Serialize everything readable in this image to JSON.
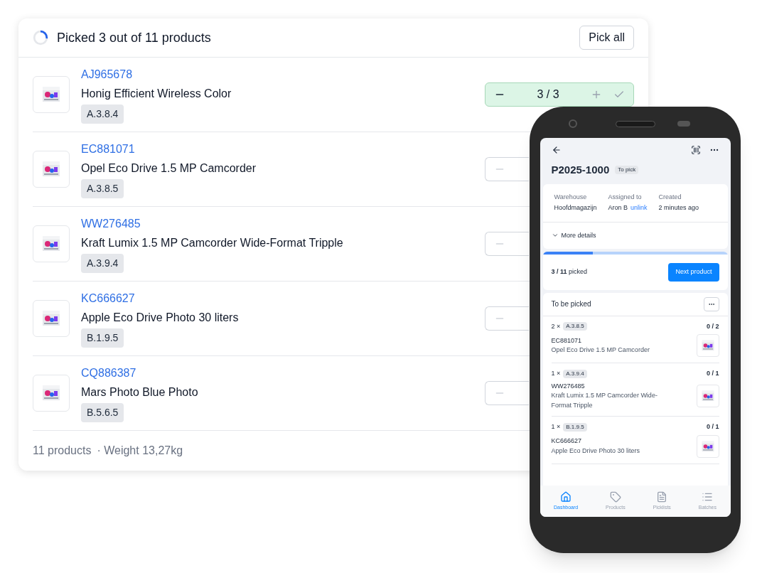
{
  "picking_card": {
    "title": "Picked 3 out of 11 products",
    "pick_all_button": "Pick all",
    "products": [
      {
        "sku": "AJ965678",
        "name": "Honig Efficient Wireless Color",
        "location": "A.3.8.4",
        "stepper": {
          "value": "3 / 3",
          "complete": true
        }
      },
      {
        "sku": "EC881071",
        "name": "Opel Eco Drive 1.5 MP Camcorder",
        "location": "A.3.8.5",
        "stepper": {
          "complete": false
        }
      },
      {
        "sku": "WW276485",
        "name": "Kraft Lumix 1.5 MP Camcorder Wide-Format Tripple",
        "location": "A.3.9.4",
        "stepper": {
          "complete": false
        }
      },
      {
        "sku": "KC666627",
        "name": "Apple Eco Drive Photo 30 liters",
        "location": "B.1.9.5",
        "stepper": {
          "complete": false
        }
      },
      {
        "sku": "CQ886387",
        "name": "Mars Photo Blue Photo",
        "location": "B.5.6.5",
        "stepper": {
          "complete": false
        }
      }
    ],
    "footer": {
      "count": "11 products",
      "weight": "· Weight 13,27kg"
    }
  },
  "phone": {
    "picklist_id": "P2025-1000",
    "status": "To pick",
    "details": [
      {
        "label": "Warehouse",
        "value": "Hoofdmagazijn"
      },
      {
        "label": "Assigned to",
        "value": "Aron B",
        "link": "unlink"
      },
      {
        "label": "Created",
        "value": "2 minutes ago"
      }
    ],
    "more_details": "More details",
    "progress": {
      "level": 0.27,
      "text": "**3 / 11** picked",
      "button": "Next product"
    },
    "list_title": "To be picked",
    "items": [
      {
        "qty": "2 ×",
        "location": "A.3.8.5",
        "count": "0 / 2",
        "sku": "EC881071",
        "name": "Opel Eco Drive 1.5 MP Camcorder"
      },
      {
        "qty": "1 ×",
        "location": "A.3.9.4",
        "count": "0 / 1",
        "sku": "WW276485",
        "name": "Kraft Lumix 1.5 MP Camcorder Wide-Format Tripple"
      },
      {
        "qty": "1 ×",
        "location": "B.1.9.5",
        "count": "0 / 1",
        "sku": "KC666627",
        "name": "Apple Eco Drive Photo 30 liters"
      }
    ],
    "nav": [
      {
        "label": "Dashboard",
        "selected": true
      },
      {
        "label": "Products",
        "selected": false
      },
      {
        "label": "Picklists",
        "selected": false
      },
      {
        "label": "Batches",
        "selected": false
      }
    ]
  }
}
